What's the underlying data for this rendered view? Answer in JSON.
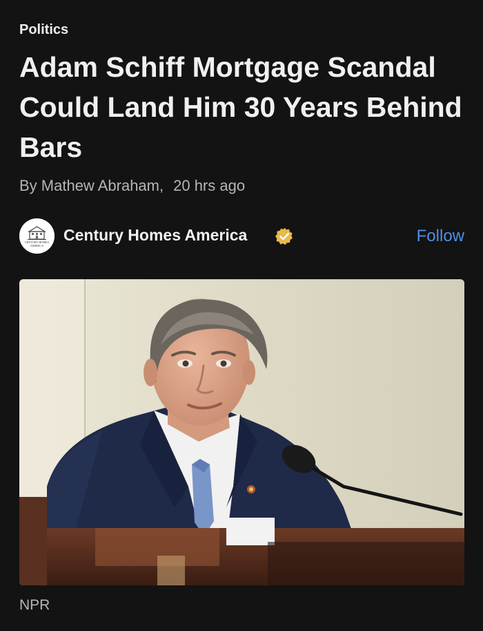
{
  "article": {
    "category": "Politics",
    "headline": "Adam Schiff Mortgage Scandal Could Land Him 30 Years Behind Bars",
    "author": "By Mathew Abraham,",
    "time": "20 hrs ago",
    "image_credit": "NPR"
  },
  "publisher": {
    "name": "Century Homes America",
    "logo_text": "CENTURY HOMES AMERICA",
    "verified_icon": "verified-badge-icon",
    "follow_label": "Follow"
  },
  "colors": {
    "background": "#131313",
    "follow": "#4d8fe8",
    "verified_badge": "#e8b84a"
  }
}
